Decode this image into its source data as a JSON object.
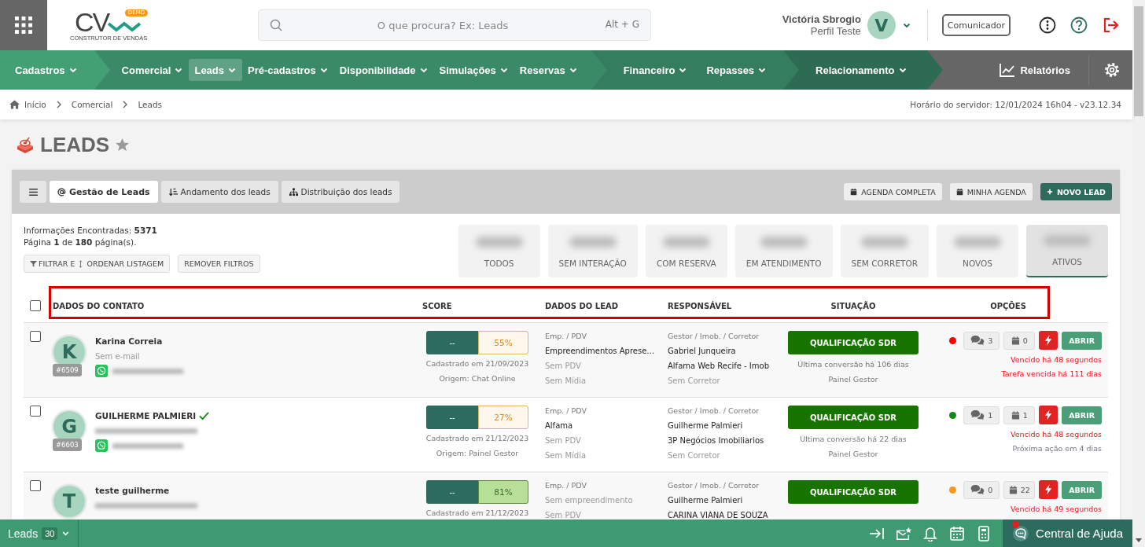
{
  "header": {
    "logo": {
      "text": "CV",
      "badge": "DEMO",
      "tagline": "CONSTRUTOR DE VENDAS"
    },
    "search": {
      "placeholder": "O que procura? Ex: Leads",
      "shortcut": "Alt + G"
    },
    "user": {
      "name": "Victória Sbrogio",
      "profile": "Perfil Teste",
      "initial": "V"
    },
    "communicator": "Comunicador"
  },
  "nav": {
    "sections": [
      {
        "items": [
          {
            "label": "Cadastros",
            "selected": false
          }
        ]
      },
      {
        "items": [
          {
            "label": "Comercial",
            "selected": false
          },
          {
            "label": "Leads",
            "selected": true
          },
          {
            "label": "Pré-cadastros",
            "selected": false
          },
          {
            "label": "Disponibilidade",
            "selected": false
          },
          {
            "label": "Simulações",
            "selected": false
          },
          {
            "label": "Reservas",
            "selected": false
          }
        ]
      },
      {
        "items": [
          {
            "label": "Financeiro",
            "selected": false
          },
          {
            "label": "Repasses",
            "selected": false
          }
        ]
      },
      {
        "items": [
          {
            "label": "Relacionamento",
            "selected": false
          }
        ]
      }
    ],
    "reports": "Relatórios"
  },
  "breadcrumb": [
    "Início",
    "Comercial",
    "Leads"
  ],
  "server_time": "Horário do servidor: 12/01/2024 16h04 - v23.12.34",
  "page_title": {
    "text": "LEADS",
    "favorite": false
  },
  "tabs": [
    {
      "label": "Gestão de Leads",
      "selected": true
    },
    {
      "label": "Andamento dos leads",
      "selected": false
    },
    {
      "label": "Distribuição dos leads",
      "selected": false
    }
  ],
  "actions": [
    {
      "label": "AGENDA COMPLETA",
      "kind": "calendar"
    },
    {
      "label": "MINHA AGENDA",
      "kind": "calendar"
    },
    {
      "label": "NOVO LEAD",
      "kind": "primary"
    }
  ],
  "summary": [
    "Informações Encontradas: **5371**",
    "Página **1** de **180** página(s)."
  ],
  "filter_button": {
    "label_start": "FILTRAR E",
    "label_end": "ORDENAR LISTAGEM"
  },
  "clear_button": "REMOVER FILTROS",
  "status_cards": [
    {
      "label": "TODOS",
      "selected": false
    },
    {
      "label": "SEM INTERAÇÃO",
      "selected": false
    },
    {
      "label": "COM RESERVA",
      "selected": false
    },
    {
      "label": "EM ATENDIMENTO",
      "selected": false
    },
    {
      "label": "SEM CORRETOR",
      "selected": false
    },
    {
      "label": "NOVOS",
      "selected": false
    },
    {
      "label": "ATIVOS",
      "selected": true
    }
  ],
  "table": {
    "select_all": false,
    "columns": [
      "DADOS DO CONTATO",
      "SCORE",
      "DADOS DO LEAD",
      "RESPONSÁVEL",
      "SITUAÇÃO",
      "OPÇÕES"
    ],
    "rows": [
      {
        "checked": false,
        "initial": "K",
        "id": "#6509",
        "name": "Karina Correia",
        "verified": false,
        "contact": [
          {
            "kind": "email",
            "redacted": false,
            "text": "Sem e-mail"
          },
          {
            "kind": "whatsapp",
            "redacted": true
          }
        ],
        "score": {
          "left": "--",
          "value": "55%",
          "high": false
        },
        "registered": "Cadastrado em 21/09/2023",
        "origin": "Origem: Chat Online",
        "lead_label": "Emp. / PDV",
        "lead": [
          {
            "text": "Empreendimentos Aprese…",
            "muted": false
          },
          {
            "text": "Sem PDV",
            "muted": true
          },
          {
            "text": "Sem Mídia",
            "muted": true
          }
        ],
        "responsible_label": "Gestor / Imob. / Corretor",
        "responsible": [
          {
            "text": "Gabriel Junqueira",
            "muted": false
          },
          {
            "text": "Alfama Web Recife - Imob",
            "muted": false
          },
          {
            "text": "Sem Corretor",
            "muted": true
          }
        ],
        "status": "QUALIFICAÇÃO SDR",
        "last_conversation": "Última conversão há 106 dias",
        "channel": "Painel Gestor",
        "color": "#ff0000",
        "messages": "3",
        "tasks": "0",
        "open_label": "ABRIR",
        "alerts": [
          {
            "text": "Vencido há 48 segundos",
            "overdue": true
          },
          {
            "text": "Tarefa vencida há 111 dias",
            "overdue": true
          }
        ]
      },
      {
        "checked": false,
        "initial": "G",
        "id": "#6603",
        "name": "GUILHERME PALMIERI",
        "verified": true,
        "contact": [
          {
            "kind": "email",
            "redacted": true
          },
          {
            "kind": "whatsapp",
            "redacted": true
          }
        ],
        "score": {
          "left": "--",
          "value": "27%",
          "high": false
        },
        "registered": "Cadastrado em 21/12/2023",
        "origin": "Origem: Painel Gestor",
        "lead_label": "Emp. / PDV",
        "lead": [
          {
            "text": "Alfama",
            "muted": false
          },
          {
            "text": "Sem PDV",
            "muted": true
          },
          {
            "text": "Sem Mídia",
            "muted": true
          }
        ],
        "responsible_label": "Gestor / Imob. / Corretor",
        "responsible": [
          {
            "text": "Guilherme Palmieri",
            "muted": false
          },
          {
            "text": "3P Negócios Imobiliarios",
            "muted": false
          },
          {
            "text": "Sem Corretor",
            "muted": true
          }
        ],
        "status": "QUALIFICAÇÃO SDR",
        "last_conversation": "Última conversão há 22 dias",
        "channel": "Painel Gestor",
        "color": "#138a13",
        "messages": "1",
        "tasks": "1",
        "open_label": "ABRIR",
        "alerts": [
          {
            "text": "Vencido há 48 segundos",
            "overdue": true
          },
          {
            "text": "Próxima ação em 4 dias",
            "overdue": false
          }
        ]
      },
      {
        "checked": false,
        "initial": "T",
        "name": "teste guilherme",
        "verified": false,
        "contact": [
          {
            "kind": "email",
            "redacted": true
          }
        ],
        "score": {
          "left": "--",
          "value": "81%",
          "high": true
        },
        "registered": "Cadastrado em 21/12/2023",
        "lead_label": "Emp. / PDV",
        "lead": [
          {
            "text": "Sem empreendimento",
            "muted": true
          },
          {
            "text": "Sem PDV",
            "muted": true
          }
        ],
        "responsible_label": "Gestor / Imob. / Corretor",
        "responsible": [
          {
            "text": "Guilherme Palmieri",
            "muted": false
          },
          {
            "text": "CARINA VIANA DE SOUZA",
            "muted": false
          }
        ],
        "status": "QUALIFICAÇÃO SDR",
        "color": "#f39a1e",
        "messages": "0",
        "tasks": "22",
        "open_label": "ABRIR",
        "alerts": [
          {
            "text": "Vencido há 49 segundos",
            "overdue": true
          }
        ]
      }
    ]
  },
  "footer": {
    "label": "Leads",
    "count": "30",
    "help": "Central de Ajuda",
    "help_notification": true
  }
}
